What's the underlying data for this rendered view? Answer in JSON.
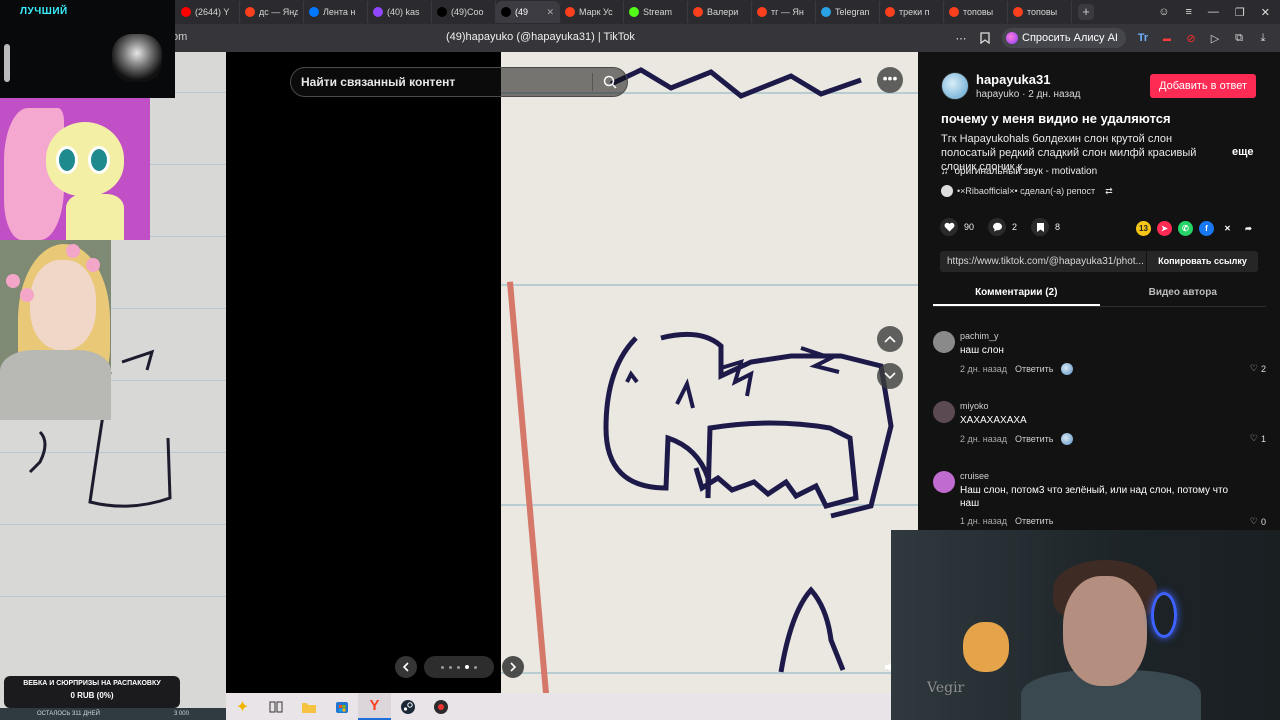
{
  "browser": {
    "tabs": [
      {
        "title": "(2644) Y",
        "color": "#ff0000"
      },
      {
        "title": "дс — Янд",
        "color": "#fc3f1d"
      },
      {
        "title": "Лента н",
        "color": "#0077ff"
      },
      {
        "title": "(40) kas",
        "color": "#9146ff"
      },
      {
        "title": "(49)Coo",
        "color": "#000000"
      },
      {
        "title": "(49",
        "color": "#000000",
        "active": true
      },
      {
        "title": "Марк Ус",
        "color": "#fc3f1d"
      },
      {
        "title": "Stream",
        "color": "#53fc18"
      },
      {
        "title": "Валери",
        "color": "#fc3f1d"
      },
      {
        "title": "тг — Ян",
        "color": "#fc3f1d"
      },
      {
        "title": "Telegran",
        "color": "#2aa3e6"
      },
      {
        "title": "треки п",
        "color": "#fc3f1d"
      },
      {
        "title": "топовы",
        "color": "#fc3f1d"
      },
      {
        "title": "топовы",
        "color": "#fc3f1d"
      }
    ],
    "url_fragment": "om",
    "page_title": "(49)hapayuko (@hapayuka31) | TikTok",
    "alice_label": "Спросить Алису AI"
  },
  "stream_overlay": {
    "top_tag": "ЛУЧШИЙ",
    "promo_line1": "ВЕБКА И СЮРПРИЗЫ НА РАСПАКОВКУ",
    "promo_line2": "0 RUB (0%)",
    "promo_sub_left": "ОСТАЛОСЬ 311 ДНЕЙ",
    "promo_sub_right": "3 000"
  },
  "viewer": {
    "search_placeholder": "Найти связанный контент",
    "slide_count": 5,
    "slide_current_index": 3
  },
  "post": {
    "author_handle": "hapayuka31",
    "author_sub": "hapayuko · 2 дн. назад",
    "follow_label": "Добавить в ответ",
    "title": "почему у меня видио не удаляются",
    "description": "Тгк Hapayukohals болдехин слон крутой слон полосатый редкий сладкий слон милфй красивый слоник слоник к...",
    "more_label": "еще",
    "sound": "оригинальный звук - motivation",
    "repost": "•×Ribaofficial×• сделал(-а) репост",
    "likes": "90",
    "comments": "2",
    "saves": "8",
    "share_count": "13",
    "link": "https://www.tiktok.com/@hapayuka31/phot...",
    "copy_label": "Копировать ссылку",
    "tab_comments": "Комментарии (2)",
    "tab_author_videos": "Видео автора"
  },
  "comments": [
    {
      "name": "pachim_y",
      "text": "наш слон",
      "time": "2 дн. назад",
      "reply": "Ответить",
      "likes": "2"
    },
    {
      "name": "miyoko",
      "text": "ХАХАХАХАХА",
      "time": "2 дн. назад",
      "reply": "Ответить",
      "likes": "1"
    },
    {
      "name": "cruisee",
      "text": "Наш слон, потом3 что зелёный, или над слон, потому что наш",
      "time": "1 дн. назад",
      "reply": "Ответить",
      "likes": "0"
    }
  ],
  "webcam": {
    "sign_text": "Vegir"
  },
  "colors": {
    "accent": "#fe2c55",
    "panel_bg": "#121212",
    "taskbar_bg": "#e9e4e7"
  }
}
